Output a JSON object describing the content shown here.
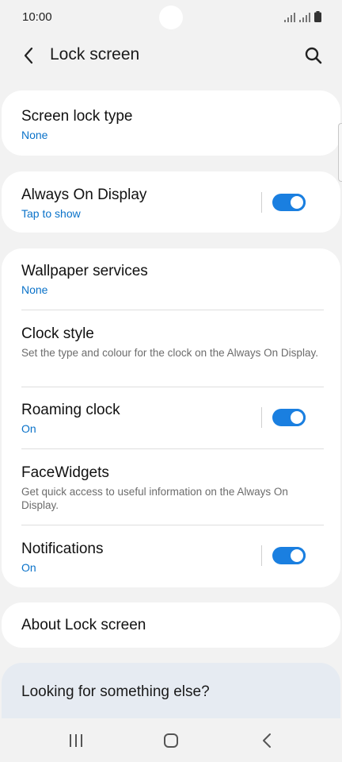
{
  "status_bar": {
    "time": "10:00"
  },
  "header": {
    "title": "Lock screen"
  },
  "cards": {
    "screen_lock": {
      "title": "Screen lock type",
      "value": "None"
    },
    "aod": {
      "title": "Always On Display",
      "value": "Tap to show",
      "enabled": true
    },
    "settings": {
      "wallpaper": {
        "title": "Wallpaper services",
        "value": "None"
      },
      "clock_style": {
        "title": "Clock style",
        "description": "Set the type and colour for the clock on the Always On Display."
      },
      "roaming_clock": {
        "title": "Roaming clock",
        "value": "On",
        "enabled": true
      },
      "facewidgets": {
        "title": "FaceWidgets",
        "description": "Get quick access to useful information on the Always On Display."
      },
      "notifications": {
        "title": "Notifications",
        "value": "On",
        "enabled": true
      }
    },
    "about": {
      "title": "About Lock screen"
    }
  },
  "help": {
    "text": "Looking for something else?"
  },
  "colors": {
    "accent": "#1a7fe0",
    "link": "#0a72c9",
    "background": "#f2f2f2",
    "help_bg": "#e6ebf2"
  },
  "icons": {
    "back": "chevron-left-icon",
    "search": "search-icon",
    "nav_recent": "recent-apps-icon",
    "nav_home": "home-icon",
    "nav_back": "back-icon"
  }
}
